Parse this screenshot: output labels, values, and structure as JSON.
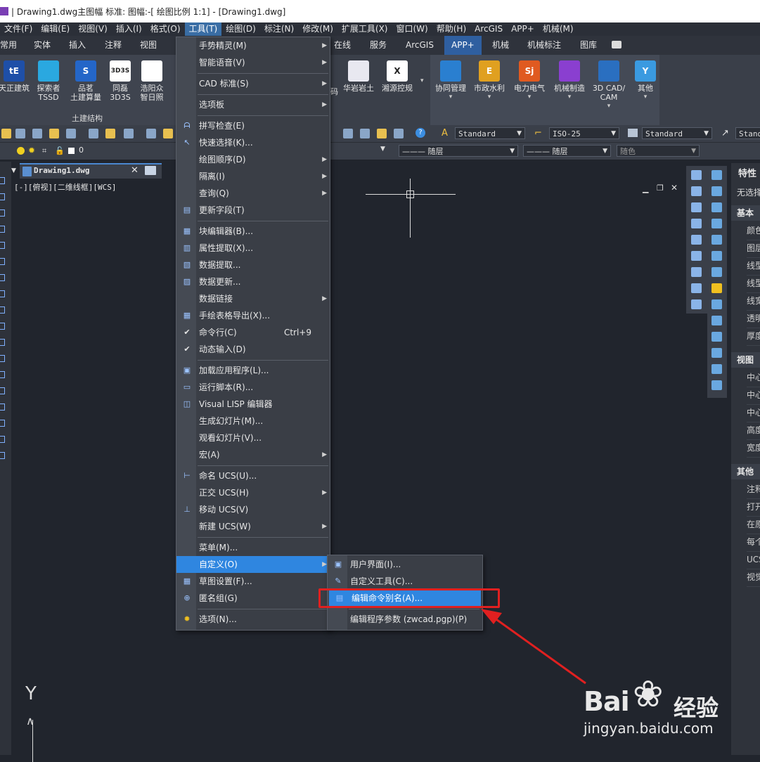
{
  "window": {
    "title": "| Drawing1.dwg主图幅 标准: 图幅:-[ 绘图比例 1:1] - [Drawing1.dwg]"
  },
  "menubar": [
    {
      "label": "文件(F)"
    },
    {
      "label": "编辑(E)"
    },
    {
      "label": "视图(V)"
    },
    {
      "label": "插入(I)"
    },
    {
      "label": "格式(O)"
    },
    {
      "label": "工具(T)"
    },
    {
      "label": "绘图(D)"
    },
    {
      "label": "标注(N)"
    },
    {
      "label": "修改(M)"
    },
    {
      "label": "扩展工具(X)"
    },
    {
      "label": "窗口(W)"
    },
    {
      "label": "帮助(H)"
    },
    {
      "label": "ArcGIS"
    },
    {
      "label": "APP+"
    },
    {
      "label": "机械(M)"
    }
  ],
  "ribbon_tabs": [
    "常用",
    "实体",
    "插入",
    "注释",
    "视图",
    "在线",
    "服务",
    "ArcGIS",
    "APP+",
    "机械",
    "机械标注",
    "图库"
  ],
  "ribbon_buttons": [
    {
      "label": "天正建筑",
      "icon": "tangent-icon"
    },
    {
      "label": "探索者\nTSSD",
      "icon": "tssd-icon"
    },
    {
      "label": "品茗\n土建算量",
      "icon": "pinming-icon"
    },
    {
      "label": "同磊\n3D3S",
      "icon": "3d3s-icon"
    },
    {
      "label": "浩阳众\n智日照",
      "icon": "sun-icon"
    },
    {
      "label": "华岩岩土",
      "icon": "huayan-icon"
    },
    {
      "label": "湘源控规",
      "icon": "xiangyuan-icon"
    },
    {
      "label": "协同管理",
      "icon": "cube-icon"
    },
    {
      "label": "市政水利",
      "icon": "water-icon"
    },
    {
      "label": "电力电气",
      "icon": "sj-icon"
    },
    {
      "label": "机械制造",
      "icon": "gear-icon"
    },
    {
      "label": "3D CAD/\nCAM",
      "icon": "3dcad-icon"
    },
    {
      "label": "其他",
      "icon": "antenna-icon"
    }
  ],
  "ribbon_partial_label": "码",
  "ribbon_group_label": "土建结构",
  "toolbar": {
    "text_style": "Standard",
    "dim_style": "ISO-25",
    "table_style": "Standard",
    "mleader_style": "Stand",
    "layer_value": "0",
    "linetype": "——— 随层",
    "lineweight": "——— 随层",
    "color": "随色"
  },
  "document_tab": {
    "name": "Drawing1.dwg"
  },
  "viewport_label": "[-][俯视][二维线框][WCS]",
  "tools_menu": [
    {
      "label": "手势精灵(M)",
      "submenu": true
    },
    {
      "label": "智能语音(V)",
      "submenu": true
    },
    {
      "sep": true
    },
    {
      "label": "CAD 标准(S)",
      "submenu": true
    },
    {
      "sep": true
    },
    {
      "label": "选项板",
      "submenu": true
    },
    {
      "sep": true
    },
    {
      "label": "拼写检查(E)",
      "icon": "spell-check-icon"
    },
    {
      "label": "快速选择(K)...",
      "icon": "quick-select-icon"
    },
    {
      "label": "绘图顺序(D)",
      "submenu": true
    },
    {
      "label": "隔离(I)",
      "submenu": true
    },
    {
      "label": "查询(Q)",
      "submenu": true
    },
    {
      "label": "更新字段(T)",
      "icon": "update-field-icon"
    },
    {
      "sep": true
    },
    {
      "label": "块编辑器(B)...",
      "icon": "block-editor-icon"
    },
    {
      "label": "属性提取(X)...",
      "icon": "attribute-extract-icon"
    },
    {
      "label": "数据提取...",
      "icon": "data-extract-icon"
    },
    {
      "label": "数据更新...",
      "icon": "data-update-icon"
    },
    {
      "label": "数据链接",
      "submenu": true
    },
    {
      "label": "手绘表格导出(X)...",
      "icon": "table-export-icon"
    },
    {
      "label": "命令行(C)",
      "shortcut": "Ctrl+9",
      "checked": true
    },
    {
      "label": "动态输入(D)",
      "checked": true
    },
    {
      "sep": true
    },
    {
      "label": "加载应用程序(L)...",
      "icon": "load-app-icon"
    },
    {
      "label": "运行脚本(R)...",
      "icon": "run-script-icon"
    },
    {
      "label": "Visual LISP 编辑器",
      "icon": "lisp-icon"
    },
    {
      "label": "生成幻灯片(M)..."
    },
    {
      "label": "观看幻灯片(V)..."
    },
    {
      "label": "宏(A)",
      "submenu": true
    },
    {
      "sep": true
    },
    {
      "label": "命名 UCS(U)...",
      "icon": "named-ucs-icon"
    },
    {
      "label": "正交 UCS(H)",
      "submenu": true
    },
    {
      "label": "移动 UCS(V)",
      "icon": "move-ucs-icon"
    },
    {
      "label": "新建 UCS(W)",
      "submenu": true
    },
    {
      "sep": true
    },
    {
      "label": "菜单(M)..."
    },
    {
      "label": "自定义(O)",
      "submenu": true,
      "highlighted": true
    },
    {
      "label": "草图设置(F)...",
      "icon": "drafting-settings-icon"
    },
    {
      "label": "匿名组(G)",
      "icon": "group-icon"
    },
    {
      "sep": true
    },
    {
      "label": "选项(N)...",
      "icon": "options-gear-icon"
    }
  ],
  "customize_submenu": [
    {
      "label": "用户界面(I)...",
      "icon": "cui-icon"
    },
    {
      "label": "自定义工具(C)...",
      "icon": "custom-tools-icon"
    },
    {
      "label": "编辑命令别名(A)...",
      "icon": "pgp-icon",
      "highlighted": true
    },
    {
      "sep": true
    },
    {
      "label": "编辑程序参数 (zwcad.pgp)(P)"
    }
  ],
  "properties_panel": {
    "title": "特性",
    "selection": "无选择",
    "sections": [
      {
        "name": "基本",
        "rows": [
          "颜色",
          "图层",
          "线型",
          "线型比例",
          "线宽",
          "透明度",
          "厚度"
        ]
      },
      {
        "name": "视图",
        "rows": [
          "中心点X",
          "中心点Y",
          "中心点Z",
          "高度",
          "宽度"
        ]
      },
      {
        "name": "其他",
        "rows": [
          "注释比例",
          "打开UCS图标",
          "在原点显示UCS图标",
          "每个视口都显示UCS",
          "UCS名称",
          "视觉样式"
        ]
      }
    ]
  },
  "watermark": {
    "brand": "Bai",
    "suffix": "经验",
    "url": "jingyan.baidu.com"
  },
  "colors": {
    "highlight": "#2f86e0",
    "annotation": "#e02020",
    "menu_bg": "#3a3e46"
  }
}
